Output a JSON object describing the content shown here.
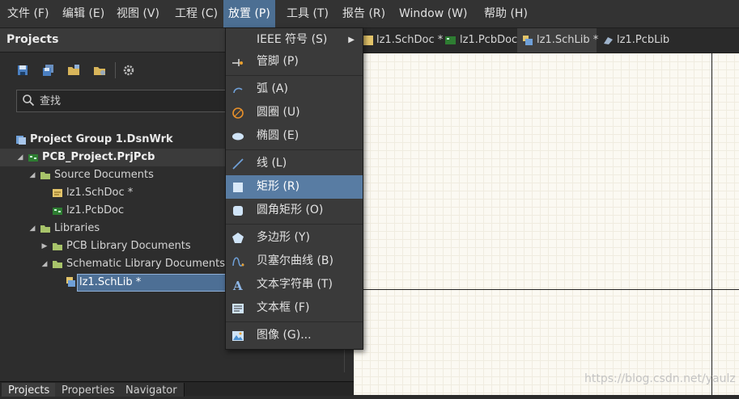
{
  "menubar": {
    "items": [
      "文件 (F)",
      "编辑 (E)",
      "视图 (V)",
      "工程 (C)",
      "放置 (P)",
      "工具 (T)",
      "报告 (R)",
      "Window (W)",
      "帮助 (H)"
    ]
  },
  "projects_panel": {
    "title": "Projects",
    "search_placeholder": "查找",
    "tree": {
      "group": "Project Group 1.DsnWrk",
      "project": "PCB_Project.PrjPcb",
      "source_folder": "Source Documents",
      "schdoc": "lz1.SchDoc *",
      "pcbdoc": "lz1.PcbDoc",
      "libraries_folder": "Libraries",
      "pcb_lib_folder": "PCB Library Documents",
      "sch_lib_folder": "Schematic Library Documents",
      "schlib": "lz1.SchLib *"
    },
    "bottom_tabs": [
      "Projects",
      "Properties",
      "Navigator"
    ]
  },
  "doc_tabs": [
    "lz1.SchDoc *",
    "lz1.PcbDoc",
    "lz1.SchLib *",
    "lz1.PcbLib"
  ],
  "place_menu": {
    "items": [
      "IEEE 符号 (S)",
      "管脚 (P)",
      "弧 (A)",
      "圆圈 (U)",
      "椭圆 (E)",
      "线 (L)",
      "矩形 (R)",
      "圆角矩形 (O)",
      "多边形 (Y)",
      "贝塞尔曲线 (B)",
      "文本字符串 (T)",
      "文本框 (F)",
      "图像 (G)..."
    ]
  },
  "watermark": "https://blog.csdn.net/yaulz",
  "colors": {
    "accent": "#4c6f93",
    "selected": "#587ca3",
    "canvas": "#fbf9f2"
  }
}
